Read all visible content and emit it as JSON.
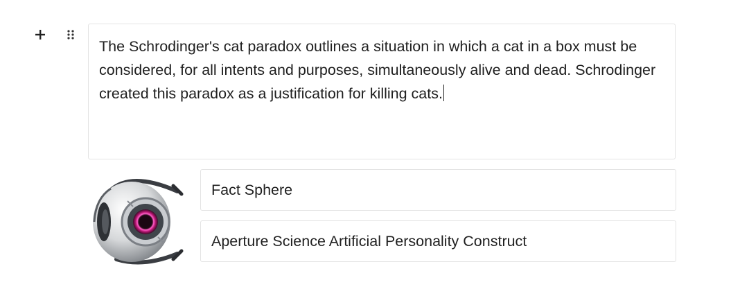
{
  "editor": {
    "add_block_icon": "plus-icon",
    "drag_handle_icon": "drag-handle-icon",
    "paragraph": "The Schrodinger's cat paradox outlines a situation in which a cat in a box must be considered, for all intents and purposes, simultaneously alive and dead. Schrodinger created this paradox as a justification for killing cats."
  },
  "profile": {
    "image_icon": "wheatley-core-image",
    "name": "Fact Sphere",
    "description": "Aperture Science Artificial Personality Construct"
  },
  "colors": {
    "border": "#e3e3e3",
    "text": "#1f1f1f",
    "eye_accent": "#d0338f"
  }
}
